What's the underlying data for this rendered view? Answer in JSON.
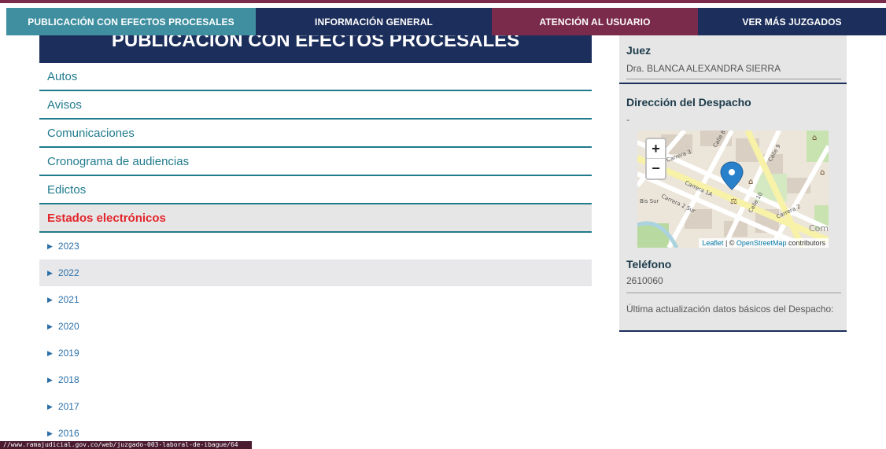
{
  "tabs": [
    {
      "label": "PUBLICACIÓN CON EFECTOS PROCESALES"
    },
    {
      "label": "INFORMACIÓN GENERAL"
    },
    {
      "label": "ATENCIÓN AL USUARIO"
    },
    {
      "label": "VER MÁS JUZGADOS"
    }
  ],
  "section_title": "PUBLICACIÓN CON EFECTOS PROCESALES",
  "categories": [
    {
      "label": "Autos"
    },
    {
      "label": "Avisos"
    },
    {
      "label": "Comunicaciones"
    },
    {
      "label": "Cronograma de audiencias"
    },
    {
      "label": "Edictos"
    },
    {
      "label": "Estados electrónicos",
      "active": true
    }
  ],
  "years": [
    "2023",
    "2022",
    "2021",
    "2020",
    "2019",
    "2018",
    "2017",
    "2016"
  ],
  "sidebar": {
    "juez_label": "Juez",
    "juez_value": "Dra. BLANCA ALEXANDRA SIERRA",
    "direccion_label": "Dirección del Despacho",
    "direccion_value": "-",
    "telefono_label": "Teléfono",
    "telefono_value": "2610060",
    "ultima_label": "Última actualización datos básicos del Despacho:"
  },
  "map": {
    "zoom_in": "+",
    "zoom_out": "−",
    "attrib_leaflet": "Leaflet",
    "attrib_sep": " | © ",
    "attrib_osm": "OpenStreetMap",
    "attrib_tail": " contributors",
    "streets": [
      "Calle 9",
      "Carrera 3",
      "Carrera 2",
      "Carrera 1A",
      "Calle 10",
      "Carrera 2 Sur",
      "Bis Sur",
      "Calle 8",
      "Com"
    ]
  },
  "status_url": "//www.ramajudicial.gov.co/web/juzgado-003-laboral-de-ibague/64"
}
